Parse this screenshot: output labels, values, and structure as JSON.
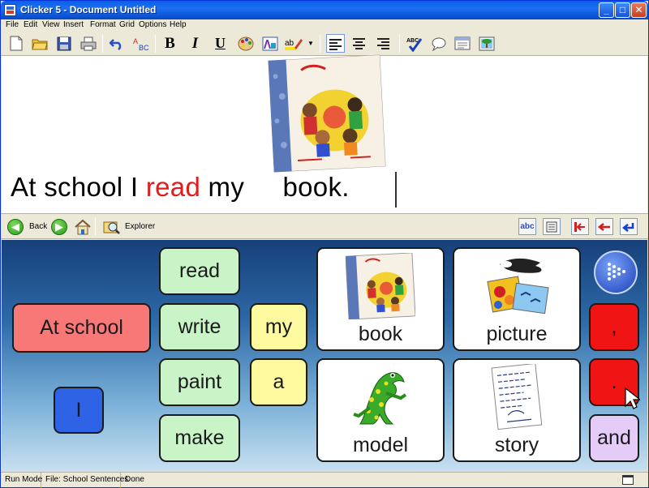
{
  "window": {
    "title": "Clicker 5 - Document Untitled"
  },
  "title_buttons": {
    "minimize": "_",
    "maximize": "□",
    "close": "✕"
  },
  "menu": [
    "File",
    "Edit",
    "View",
    "Insert",
    "Format",
    "Grid",
    "Options",
    "Help"
  ],
  "toolbar": {
    "bold": "B",
    "italic": "I",
    "underline": "U",
    "font_label": "A",
    "highlight_label": "ab",
    "spell_label": "ABC"
  },
  "document": {
    "words": [
      "At school I ",
      "read",
      " my ",
      "    book."
    ]
  },
  "navbar": {
    "back": "Back",
    "explorer": "Explorer",
    "abc_tool": "abc"
  },
  "grid": {
    "cells": [
      {
        "label": "At school",
        "color": "#F87878"
      },
      {
        "label": "I",
        "color": "#2E63E6"
      },
      {
        "label": "read",
        "color": "#C8F4C8"
      },
      {
        "label": "write",
        "color": "#C8F4C8"
      },
      {
        "label": "paint",
        "color": "#C8F4C8"
      },
      {
        "label": "make",
        "color": "#C8F4C8"
      },
      {
        "label": "my",
        "color": "#FFFAA0"
      },
      {
        "label": "a",
        "color": "#FFFAA0"
      },
      {
        "label": "book",
        "color": "#FFFFFF"
      },
      {
        "label": "picture",
        "color": "#FFFFFF"
      },
      {
        "label": "model",
        "color": "#FFFFFF"
      },
      {
        "label": "story",
        "color": "#FFFFFF"
      },
      {
        "label": ",",
        "color": "#F01414"
      },
      {
        "label": ".",
        "color": "#F01414"
      },
      {
        "label": "and",
        "color": "#E5CCF8"
      }
    ]
  },
  "status": {
    "mode": "Run Mode",
    "file": "File: School Sentences",
    "state": "Done"
  }
}
